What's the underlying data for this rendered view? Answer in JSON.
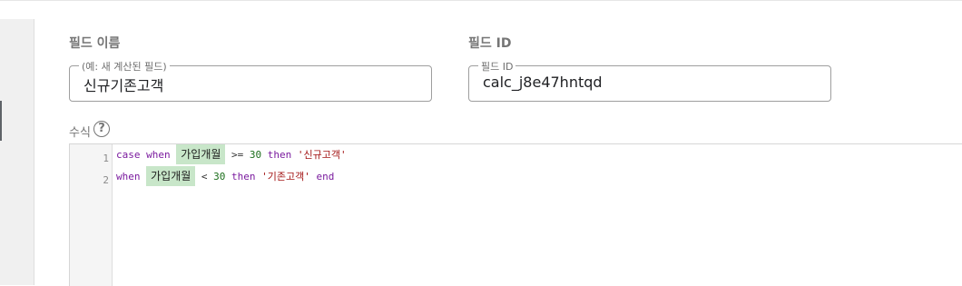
{
  "form": {
    "field_name_label": "필드 이름",
    "field_name_legend": "(예: 새 계산된 필드)",
    "field_name_value": "신규기존고객",
    "field_id_label": "필드 ID",
    "field_id_legend": "필드 ID",
    "field_id_value": "calc_j8e47hntqd",
    "formula_label": "수식",
    "help_symbol": "?"
  },
  "editor": {
    "line_numbers": [
      "1",
      "2"
    ],
    "line1": {
      "kw_case": "case",
      "kw_when": "when",
      "field": "가입개월",
      "op": ">=",
      "num": "30",
      "kw_then": "then",
      "str": "'신규고객'"
    },
    "line2": {
      "kw_when": "when",
      "field": "가입개월",
      "op": "<",
      "num": "30",
      "kw_then": "then",
      "str": "'기존고객'",
      "kw_end": "end"
    }
  },
  "colors": {
    "keyword": "#7a1a9e",
    "number": "#1b6e1b",
    "string": "#a31515",
    "field_chip_bg": "#c8e6c9"
  }
}
